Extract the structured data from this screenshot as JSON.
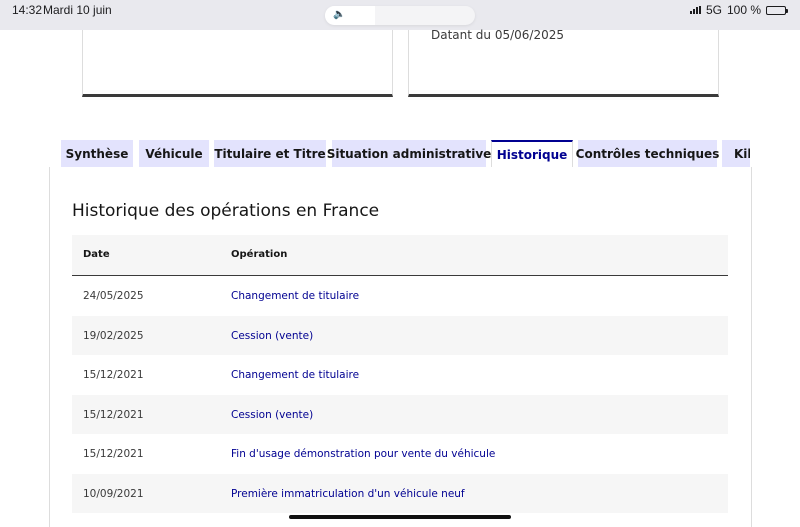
{
  "status_bar": {
    "time": "14:32",
    "date": "Mardi 10 juin",
    "network": "5G",
    "battery": "100 %",
    "battery_level": 1.0,
    "volume_level": 0.33,
    "volume_icon": "speaker-icon"
  },
  "top_cards": {
    "card2_text": "Datant du 05/06/2025"
  },
  "tabs": [
    {
      "label": "Synthèse",
      "active": false
    },
    {
      "label": "Véhicule",
      "active": false
    },
    {
      "label": "Titulaire et Titre",
      "active": false
    },
    {
      "label": "Situation administrative",
      "active": false
    },
    {
      "label": "Historique",
      "active": true
    },
    {
      "label": "Contrôles techniques",
      "active": false
    },
    {
      "label": "Kilo",
      "active": false
    }
  ],
  "section": {
    "title": "Historique des opérations en France"
  },
  "table": {
    "headers": {
      "date": "Date",
      "operation": "Opération"
    },
    "rows": [
      {
        "date": "24/05/2025",
        "operation": "Changement de titulaire"
      },
      {
        "date": "19/02/2025",
        "operation": "Cession (vente)"
      },
      {
        "date": "15/12/2021",
        "operation": "Changement de titulaire"
      },
      {
        "date": "15/12/2021",
        "operation": "Cession (vente)"
      },
      {
        "date": "15/12/2021",
        "operation": "Fin d'usage démonstration pour vente du véhicule"
      },
      {
        "date": "10/09/2021",
        "operation": "Première immatriculation d'un véhicule neuf"
      }
    ]
  },
  "colors": {
    "accent": "#000091",
    "tab_background": "#e3e3fd",
    "row_alt": "#f6f6f6"
  }
}
